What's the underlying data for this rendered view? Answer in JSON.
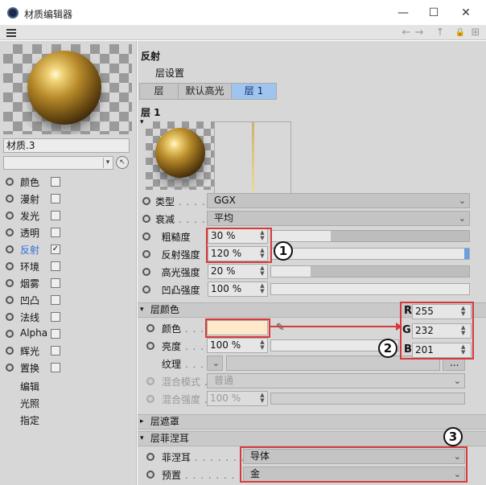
{
  "window": {
    "title": "材质编辑器",
    "minimize": "—",
    "maximize": "☐",
    "close": "✕"
  },
  "nav": {
    "back": "←",
    "forward": "→",
    "up": "↑",
    "lock": "🔒",
    "new": "⊞"
  },
  "material": {
    "name": "材质.3",
    "channels": [
      {
        "label": "颜色",
        "checked": false
      },
      {
        "label": "漫射",
        "checked": false
      },
      {
        "label": "发光",
        "checked": false
      },
      {
        "label": "透明",
        "checked": false
      },
      {
        "label": "反射",
        "checked": true,
        "active": true
      },
      {
        "label": "环境",
        "checked": false
      },
      {
        "label": "烟雾",
        "checked": false
      },
      {
        "label": "凹凸",
        "checked": false
      },
      {
        "label": "法线",
        "checked": false
      },
      {
        "label": "Alpha",
        "checked": false
      },
      {
        "label": "辉光",
        "checked": false
      },
      {
        "label": "置换",
        "checked": false
      }
    ],
    "extra_items": [
      "编辑",
      "光照",
      "指定"
    ]
  },
  "reflect": {
    "title": "反射",
    "layer_settings": "层设置",
    "tabs": [
      "层",
      "默认高光",
      "层 1"
    ],
    "layer_title": "层 1",
    "type_label": "类型",
    "type_value": "GGX",
    "attenuation_label": "衰减",
    "attenuation_value": "平均",
    "roughness_label": "粗糙度",
    "roughness_value": "30 %",
    "roughness_fraction": 0.3,
    "reflect_strength_label": "反射强度",
    "reflect_strength_value": "120 %",
    "reflect_strength_fraction": 1.0,
    "spec_strength_label": "高光强度",
    "spec_strength_value": "20 %",
    "spec_strength_fraction": 0.2,
    "bump_strength_label": "凹凸强度",
    "bump_strength_value": "100 %",
    "bump_strength_fraction": 1.0
  },
  "layer_color": {
    "section": "层颜色",
    "color_label": "颜色",
    "color_hex": "#ffe8c9",
    "brightness_label": "亮度",
    "brightness_value": "100 %",
    "brightness_fraction": 1.0,
    "texture_label": "纹理",
    "texture_more": "...",
    "blend_mode_label": "混合模式",
    "blend_mode_value": "普通",
    "blend_strength_label": "混合强度",
    "blend_strength_value": "100 %",
    "r_label": "R",
    "g_label": "G",
    "b_label": "B",
    "r_value": "255",
    "g_value": "232",
    "b_value": "201"
  },
  "layer_mask": {
    "section": "层遮罩"
  },
  "fresnel": {
    "section": "层菲涅耳",
    "fresnel_label": "菲涅耳",
    "fresnel_value": "导体",
    "preset_label": "预置",
    "preset_value": "金"
  },
  "callouts": [
    "1",
    "2",
    "3"
  ],
  "colors": {
    "highlight_red": "#d83a3a",
    "tab_selected": "#9fc5ee",
    "active_channel": "#2f6fd8"
  }
}
